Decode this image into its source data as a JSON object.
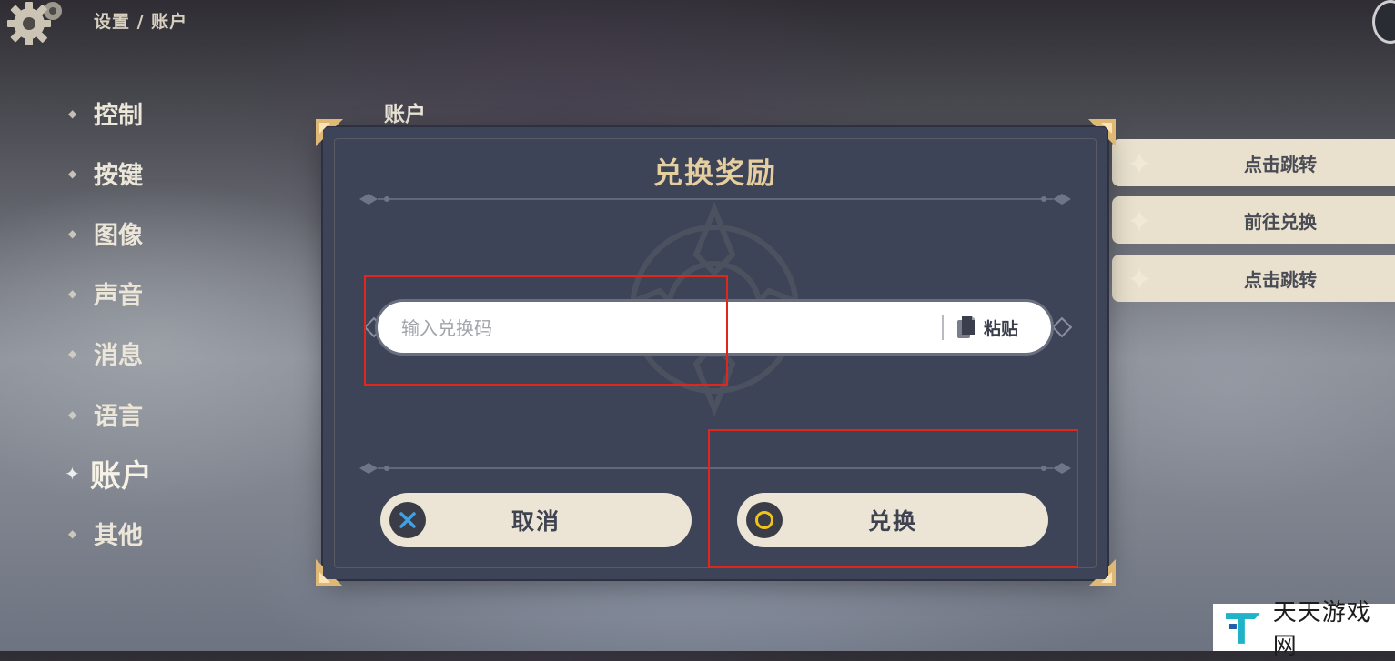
{
  "header": {
    "breadcrumb": "设置 / 账户"
  },
  "nav": {
    "items": [
      {
        "label": "控制",
        "active": false
      },
      {
        "label": "按键",
        "active": false
      },
      {
        "label": "图像",
        "active": false
      },
      {
        "label": "声音",
        "active": false
      },
      {
        "label": "消息",
        "active": false
      },
      {
        "label": "语言",
        "active": false
      },
      {
        "label": "账户",
        "active": true
      },
      {
        "label": "其他",
        "active": false
      }
    ]
  },
  "main": {
    "section_title": "账户",
    "right_buttons": [
      "点击跳转",
      "前往兑换",
      "点击跳转"
    ]
  },
  "dialog": {
    "title": "兑换奖励",
    "code_input": {
      "placeholder": "输入兑换码",
      "value": ""
    },
    "paste_label": "粘贴",
    "cancel_label": "取消",
    "redeem_label": "兑换"
  },
  "watermark": {
    "text": "天天游戏网"
  },
  "colors": {
    "dialog_bg": "#3e4457",
    "title_gold": "#e6cf9f",
    "button_cream": "#ece5d6",
    "highlight_red": "#e1261c",
    "cancel_icon_blue": "#3da3e6",
    "confirm_icon_gold": "#f0c419"
  }
}
